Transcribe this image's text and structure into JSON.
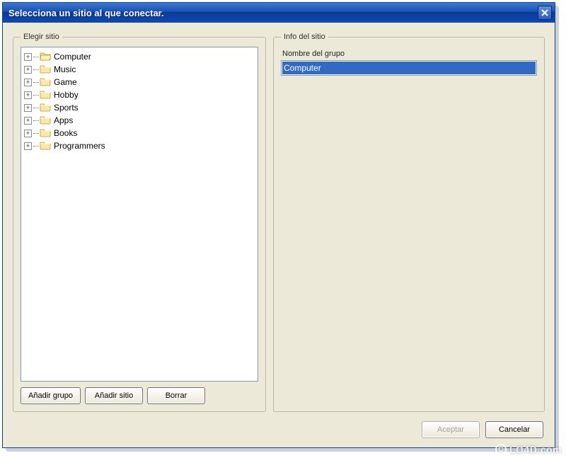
{
  "window": {
    "title": "Selecciona un sitio al que conectar."
  },
  "left_panel": {
    "legend": "Elegir sitio",
    "tree": [
      {
        "label": "Computer",
        "selected": true
      },
      {
        "label": "Music",
        "selected": false
      },
      {
        "label": "Game",
        "selected": false
      },
      {
        "label": "Hobby",
        "selected": false
      },
      {
        "label": "Sports",
        "selected": false
      },
      {
        "label": "Apps",
        "selected": false
      },
      {
        "label": "Books",
        "selected": false
      },
      {
        "label": "Programmers",
        "selected": false
      }
    ],
    "buttons": {
      "add_group": "Añadir grupo",
      "add_site": "Añadir sitio",
      "delete": "Borrar"
    }
  },
  "right_panel": {
    "legend": "Info del sitio",
    "group_name_label": "Nombre del grupo",
    "group_name_value": "Computer"
  },
  "footer": {
    "accept": "Aceptar",
    "cancel": "Cancelar"
  },
  "watermark": "LO4D.com",
  "icons": {
    "plus": "+",
    "folder_closed_fill": "#f7e9a6",
    "folder_open_fill": "#f7e38a",
    "folder_stroke": "#b59b2d"
  }
}
